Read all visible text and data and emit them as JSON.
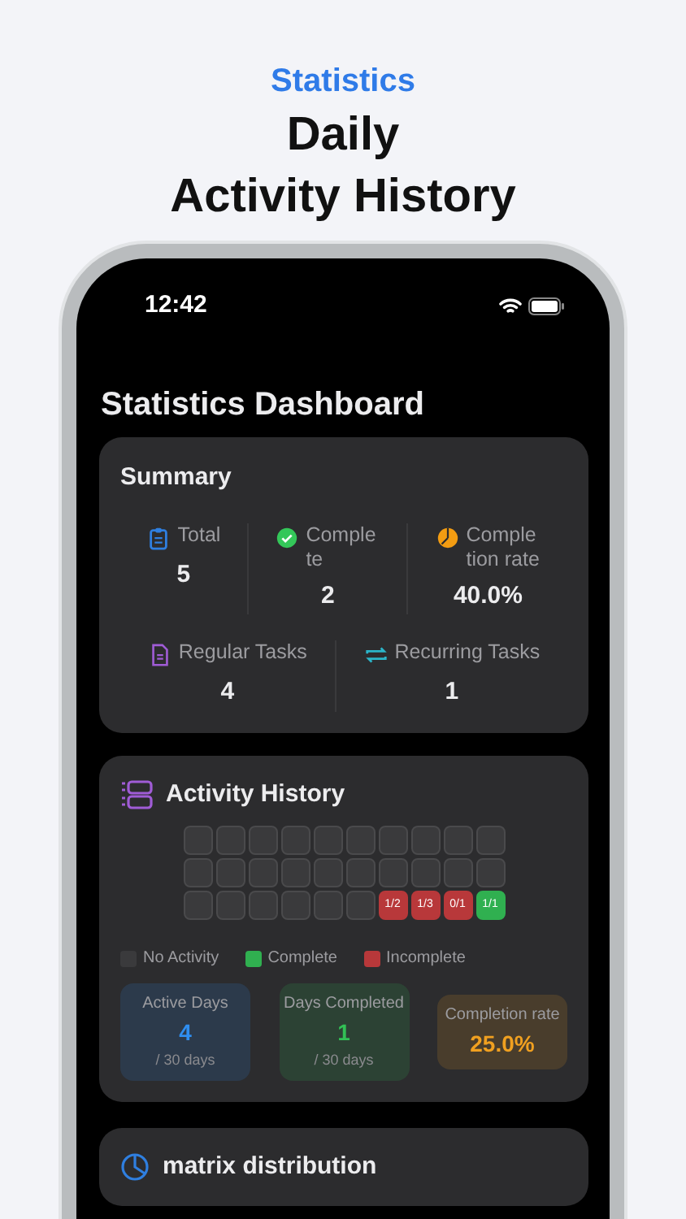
{
  "promo": {
    "eyebrow": "Statistics",
    "headline": [
      "Daily",
      "Activity History"
    ]
  },
  "status_bar": {
    "time": "12:42"
  },
  "title": "Statistics Dashboard",
  "summary": {
    "title": "Summary",
    "top": [
      {
        "label": "Total",
        "value": "5"
      },
      {
        "label": "Complete",
        "value": "2"
      },
      {
        "label": "Completion rate",
        "value": "40.0%"
      }
    ],
    "bottom": [
      {
        "label": "Regular Tasks",
        "value": "4"
      },
      {
        "label": "Recurring Tasks",
        "value": "1"
      }
    ]
  },
  "activity": {
    "title": "Activity History",
    "cells": [
      {
        "kind": "empty"
      },
      {
        "kind": "empty"
      },
      {
        "kind": "empty"
      },
      {
        "kind": "empty"
      },
      {
        "kind": "empty"
      },
      {
        "kind": "empty"
      },
      {
        "kind": "empty"
      },
      {
        "kind": "empty"
      },
      {
        "kind": "empty"
      },
      {
        "kind": "empty"
      },
      {
        "kind": "empty"
      },
      {
        "kind": "empty"
      },
      {
        "kind": "empty"
      },
      {
        "kind": "empty"
      },
      {
        "kind": "empty"
      },
      {
        "kind": "empty"
      },
      {
        "kind": "empty"
      },
      {
        "kind": "empty"
      },
      {
        "kind": "empty"
      },
      {
        "kind": "empty"
      },
      {
        "kind": "empty"
      },
      {
        "kind": "empty"
      },
      {
        "kind": "empty"
      },
      {
        "kind": "empty"
      },
      {
        "kind": "empty"
      },
      {
        "kind": "empty"
      },
      {
        "kind": "incomplete",
        "label": "1/2"
      },
      {
        "kind": "incomplete",
        "label": "1/3"
      },
      {
        "kind": "incomplete",
        "label": "0/1"
      },
      {
        "kind": "complete",
        "label": "1/1"
      }
    ],
    "legend": [
      {
        "label": "No Activity",
        "color": "#3a3a3c"
      },
      {
        "label": "Complete",
        "color": "#30b050"
      },
      {
        "label": "Incomplete",
        "color": "#b8383a"
      }
    ],
    "stats": [
      {
        "label": "Active Days",
        "value": "4",
        "sub": "/ 30 days",
        "color": "#2f8ef0"
      },
      {
        "label": "Days Completed",
        "value": "1",
        "sub": "/ 30 days",
        "color": "#32c055"
      },
      {
        "label": "Completion rate",
        "value": "25.0%",
        "color": "#f0a020"
      }
    ]
  },
  "matrix": {
    "title": "matrix distribution"
  }
}
